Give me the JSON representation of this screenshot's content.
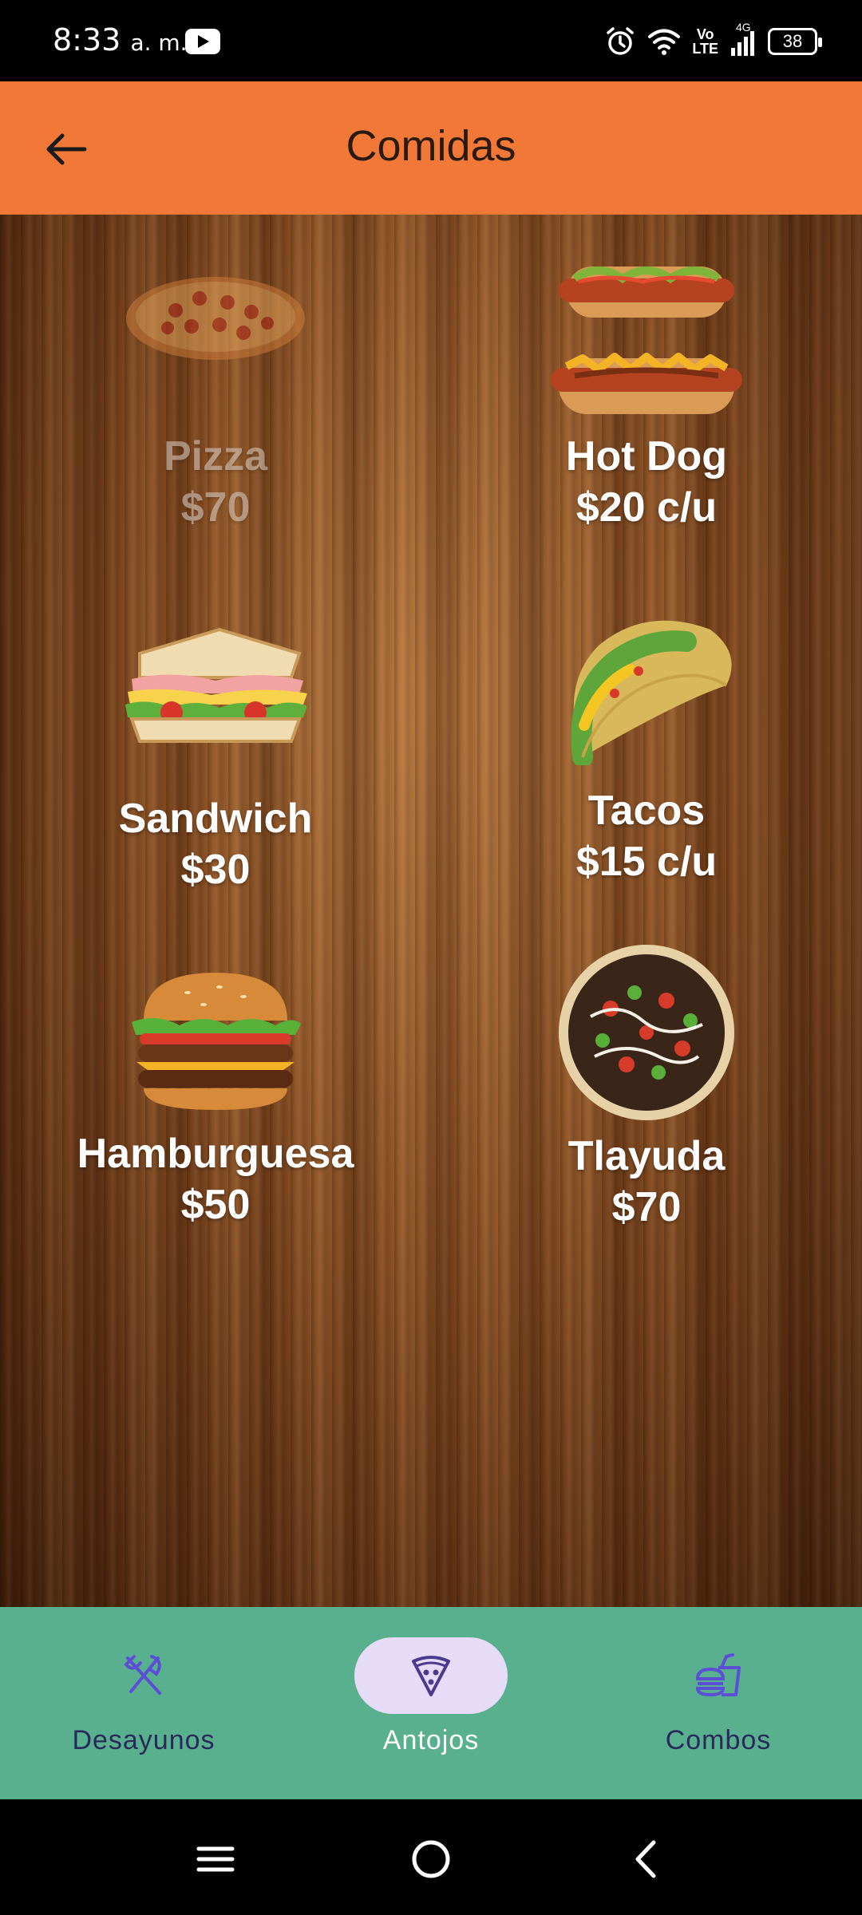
{
  "status_bar": {
    "time": "8:33",
    "ampm": "a. m.",
    "network_top": "Vo",
    "network_bottom": "LTE",
    "network_gen": "4G",
    "battery": "38"
  },
  "app_bar": {
    "title": "Comidas",
    "back_icon": "arrow-left-icon"
  },
  "menu": {
    "items": [
      {
        "name": "Pizza",
        "price": "$70",
        "icon": "pizza-image"
      },
      {
        "name": "Hot Dog",
        "price": "$20 c/u",
        "icon": "hot-dog-image"
      },
      {
        "name": "Sandwich",
        "price": "$30",
        "icon": "sandwich-image"
      },
      {
        "name": "Tacos",
        "price": "$15 c/u",
        "icon": "taco-image"
      },
      {
        "name": "Hamburguesa",
        "price": "$50",
        "icon": "hamburger-image"
      },
      {
        "name": "Tlayuda",
        "price": "$70",
        "icon": "tlayuda-image"
      }
    ]
  },
  "bottom_nav": {
    "items": [
      {
        "label": "Desayunos",
        "icon": "fork-knife-icon",
        "active": false
      },
      {
        "label": "Antojos",
        "icon": "pizza-slice-icon",
        "active": true
      },
      {
        "label": "Combos",
        "icon": "burger-drink-icon",
        "active": false
      }
    ],
    "accent": "#58b08e",
    "active_pill": "#e7dcf7"
  },
  "colors": {
    "app_bar": "#f27837",
    "icon_purple": "#5c4fd6"
  }
}
